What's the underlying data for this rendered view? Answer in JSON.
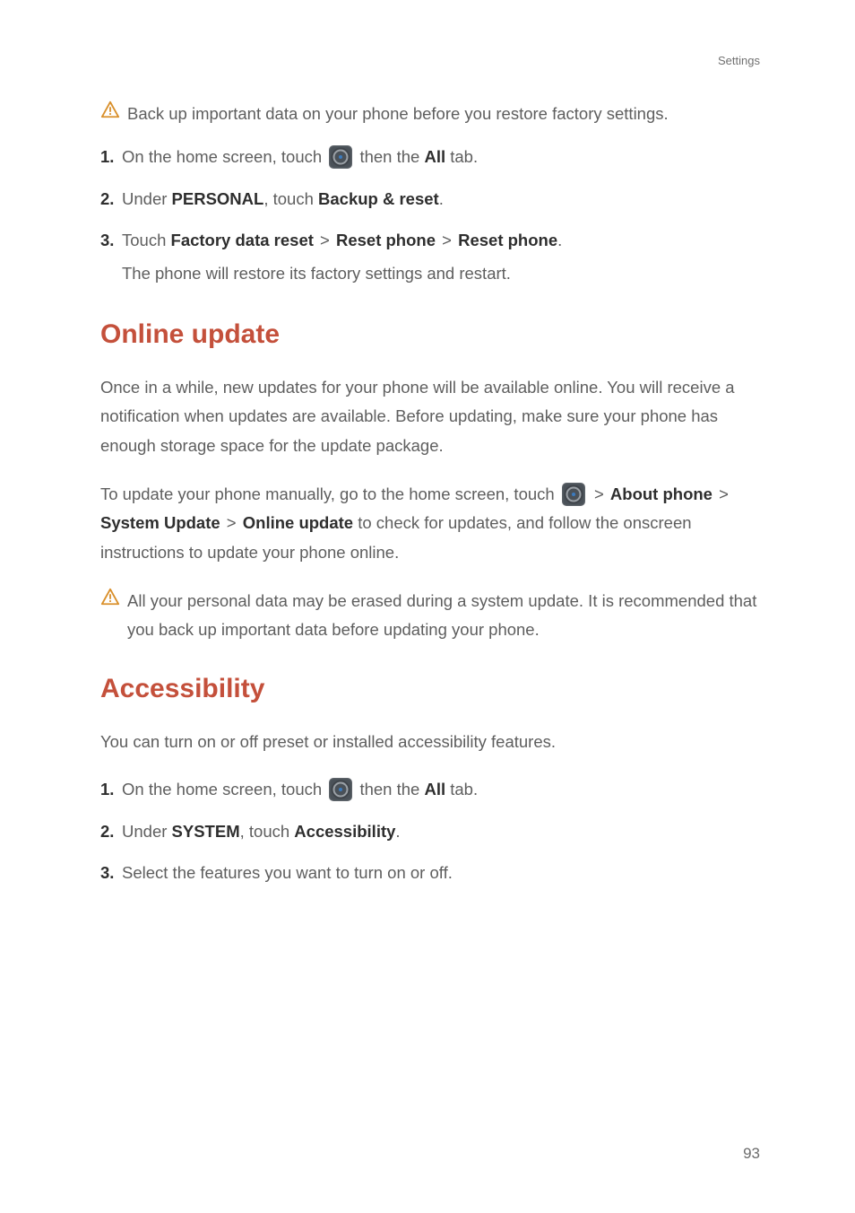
{
  "header": {
    "section_label": "Settings"
  },
  "warnings": {
    "backup_before_restore": "Back up important data on your phone before you restore factory settings.",
    "erase_on_update": "All your personal data may be erased during a system update. It is recommended that you back up important data before updating your phone."
  },
  "restore_steps": {
    "s1_prefix": "On the home screen, touch ",
    "s1_suffix_before_bold": "then the ",
    "s1_bold": "All",
    "s1_suffix_after_bold": " tab.",
    "s2_prefix": "Under ",
    "s2_bold1": "PERSONAL",
    "s2_mid": ", touch ",
    "s2_bold2": "Backup & reset",
    "s2_end": ".",
    "s3_prefix": "Touch ",
    "s3_bold1": "Factory data reset",
    "s3_bold2": "Reset phone",
    "s3_bold3": "Reset phone",
    "s3_end": ".",
    "s3_sub": "The phone will restore its factory settings and restart."
  },
  "sections": {
    "online_update_title": "Online update",
    "accessibility_title": "Accessibility"
  },
  "online_update": {
    "p1": "Once in a while, new updates for your phone will be available online. You will receive a notification when updates are available. Before updating, make sure your phone has enough storage space for the update package.",
    "p2_prefix": "To update your phone manually, go to the home screen, touch ",
    "p2_gt": " > ",
    "p2_bold_about": "About phone",
    "p2_bold_system_update": "System Update",
    "p2_bold_online_update": "Online update",
    "p2_suffix": " to check for updates, and follow the onscreen instructions to update your phone online."
  },
  "accessibility": {
    "intro": "You can turn on or off preset or installed accessibility features.",
    "s1_prefix": "On the home screen, touch ",
    "s1_suffix_before_bold": "then the ",
    "s1_bold": "All",
    "s1_suffix_after_bold": " tab.",
    "s2_prefix": "Under ",
    "s2_bold1": "SYSTEM",
    "s2_mid": ", touch ",
    "s2_bold2": "Accessibility",
    "s2_end": ".",
    "s3": "Select the features you want to turn on or off."
  },
  "nums": {
    "n1": "1.",
    "n2": "2.",
    "n3": "3."
  },
  "sep": " > ",
  "page_number": "93"
}
